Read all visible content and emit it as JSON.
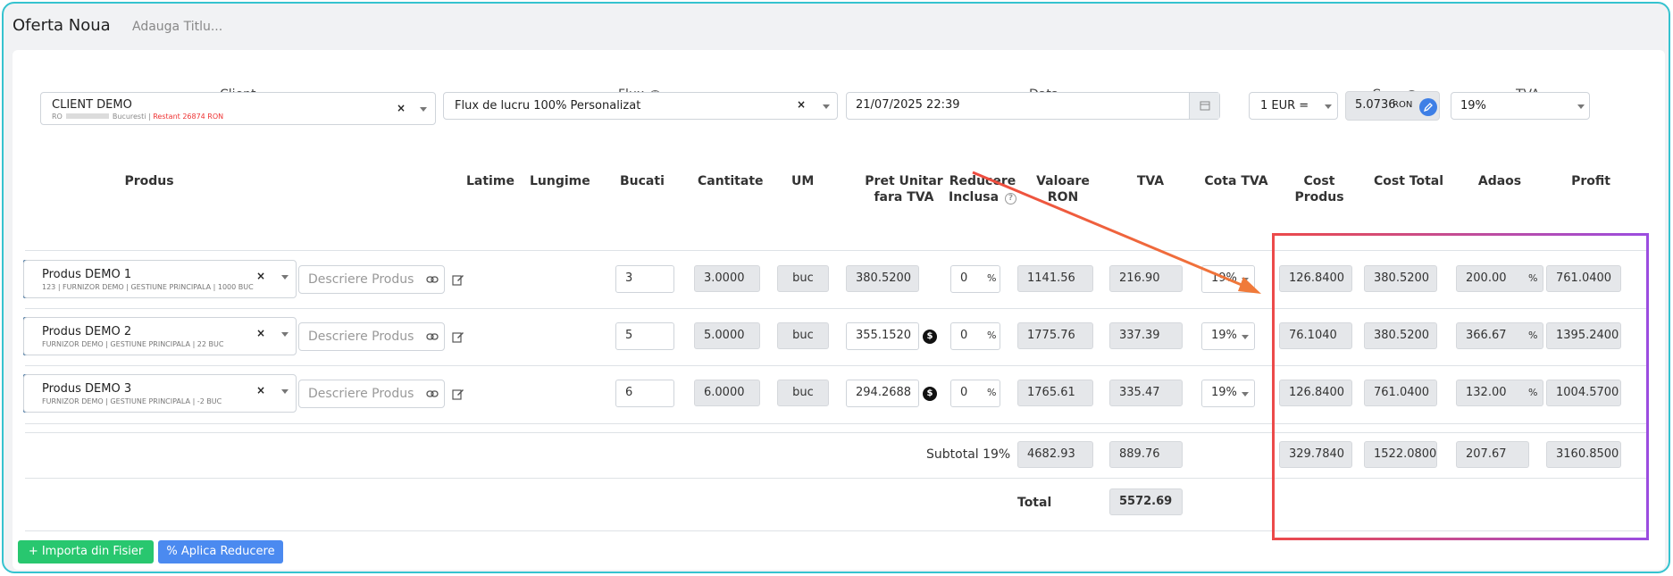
{
  "header": {
    "title": "Oferta Noua",
    "subtitle_placeholder": "Adauga Titlu..."
  },
  "form": {
    "client_label": "Client",
    "client_name": "CLIENT DEMO",
    "client_sub_prefix": "RO",
    "client_sub_city": "Bucuresti |",
    "client_sub_overdue": "Restant 26874 RON",
    "flux_label": "Flux",
    "flux_value": "Flux de lucru 100% Personalizat",
    "data_label": "Data",
    "data_value": "21/07/2025 22:39",
    "curs_label": "Curs",
    "currency_value": "1 EUR =",
    "rate_value": "5.0736",
    "rate_unit": "RON",
    "tva_label": "TVA",
    "tva_value": "19%"
  },
  "columns": {
    "produs": "Produs",
    "latime": "Latime",
    "lungime": "Lungime",
    "bucati": "Bucati",
    "cantitate": "Cantitate",
    "um": "UM",
    "pret1": "Pret Unitar",
    "pret2": "fara TVA",
    "reducere1": "Reducere",
    "reducere2": "Inclusa",
    "valoare1": "Valoare",
    "valoare2": "RON",
    "tva": "TVA",
    "cota": "Cota TVA",
    "cost_produs": "Cost Produs",
    "cost_total": "Cost Total",
    "adaos": "Adaos",
    "profit": "Profit"
  },
  "rows": [
    {
      "name": "Produs DEMO 1",
      "sub": "123 | FURNIZOR DEMO | GESTIUNE PRINCIPALA | 1000 BUC",
      "desc_placeholder": "Descriere Produs",
      "bucati": "3",
      "cantitate": "3.0000",
      "um": "buc",
      "pret": "380.5200",
      "reducere": "0",
      "valoare": "1141.56",
      "tva": "216.90",
      "cota": "19%",
      "cost_produs": "126.8400",
      "cost_total": "380.5200",
      "adaos": "200.00",
      "profit": "761.0400"
    },
    {
      "name": "Produs DEMO 2",
      "sub": "FURNIZOR DEMO | GESTIUNE PRINCIPALA | 22 BUC",
      "desc_placeholder": "Descriere Produs",
      "bucati": "5",
      "cantitate": "5.0000",
      "um": "buc",
      "pret": "355.1520",
      "reducere": "0",
      "valoare": "1775.76",
      "tva": "337.39",
      "cota": "19%",
      "cost_produs": "76.1040",
      "cost_total": "380.5200",
      "adaos": "366.67",
      "profit": "1395.2400"
    },
    {
      "name": "Produs DEMO 3",
      "sub": "FURNIZOR DEMO | GESTIUNE PRINCIPALA | -2 BUC",
      "desc_placeholder": "Descriere Produs",
      "bucati": "6",
      "cantitate": "6.0000",
      "um": "buc",
      "pret": "294.2688",
      "reducere": "0",
      "valoare": "1765.61",
      "tva": "335.47",
      "cota": "19%",
      "cost_produs": "126.8400",
      "cost_total": "761.0400",
      "adaos": "132.00",
      "profit": "1004.5700"
    }
  ],
  "subtotal": {
    "label": "Subtotal 19%",
    "valoare": "4682.93",
    "tva": "889.76",
    "cost_produs": "329.7840",
    "cost_total": "1522.0800",
    "adaos": "207.67",
    "profit": "3160.8500"
  },
  "total": {
    "label": "Total",
    "value": "5572.69"
  },
  "symbols": {
    "percent": "%",
    "clear": "×",
    "dollar": "$"
  },
  "buttons": {
    "import": "+ Importa din Fisier",
    "discount": "% Aplica Reducere"
  },
  "annotation_colors": {
    "arrow_start": "#ee4b40",
    "arrow_end": "#f07a3a",
    "box_left": "#ec4a4a",
    "box_right": "#9b4de0"
  }
}
